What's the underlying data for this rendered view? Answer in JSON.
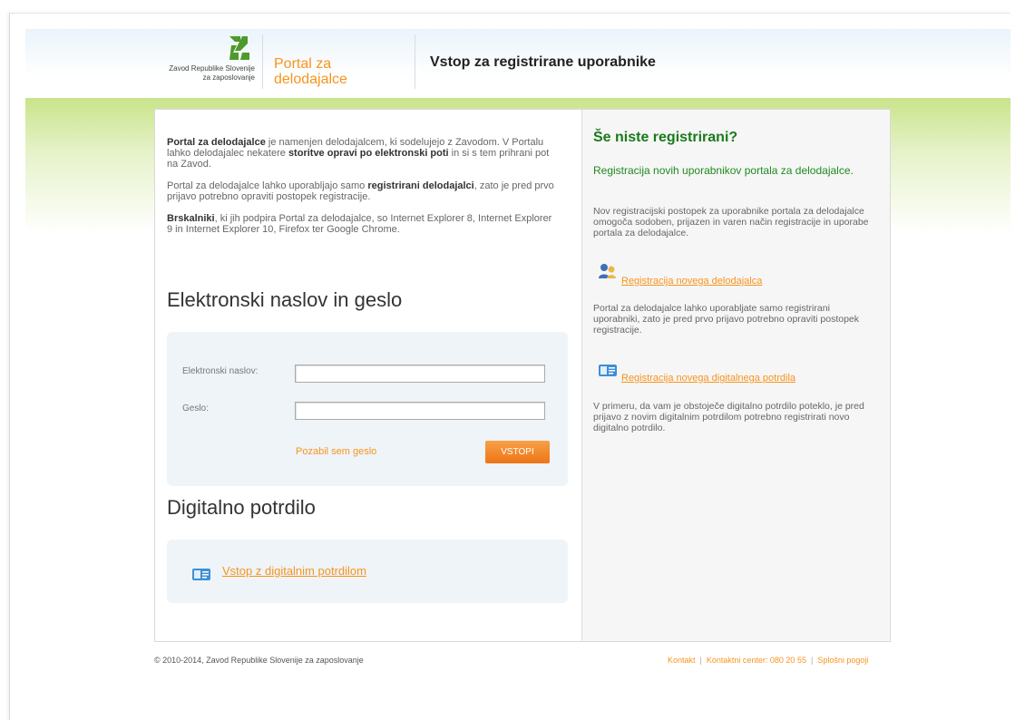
{
  "header": {
    "org_line1": "Zavod Republike Slovenije",
    "org_line2": "za zaposlovanje",
    "portal_line1": "Portal za",
    "portal_line2": "delodajalce",
    "title": "Vstop za registrirane uporabnike"
  },
  "intro": {
    "p1_b1": "Portal za delodajalce",
    "p1_t1": " je namenjen delodajalcem, ki sodelujejo z Zavodom. V Portalu lahko delodajalec nekatere ",
    "p1_b2": "storitve opravi po elektronski poti",
    "p1_t2": " in si s tem prihrani pot na Zavod.",
    "p2_t1": "Portal za delodajalce lahko uporabljajo samo ",
    "p2_b1": "registrirani delodajalci",
    "p2_t2": ", zato je pred prvo prijavo potrebno opraviti postopek registracije.",
    "p3_b1": "Brskalniki",
    "p3_t1": ", ki jih podpira Portal za delodajalce, so Internet Explorer 8, Internet Explorer 9 in Internet Explorer 10, Firefox ter Google Chrome."
  },
  "login": {
    "section_title": "Elektronski naslov in geslo",
    "email_label": "Elektronski naslov:",
    "email_value": "",
    "password_label": "Geslo:",
    "password_value": "",
    "forgot_label": "Pozabil sem geslo",
    "submit_label": "VSTOPI"
  },
  "certificate": {
    "section_title": "Digitalno potrdilo",
    "link_label": "Vstop z digitalnim potrdilom"
  },
  "sidebar": {
    "title": "Še niste registrirani?",
    "subtitle": "Registracija novih uporabnikov portala za delodajalce.",
    "text1": "Nov registracijski postopek za uporabnike portala za delodajalce omogoča sodoben, prijazen in varen način registracije in uporabe portala za delodajalce.",
    "link1": "Registracija novega delodajalca",
    "text2": "Portal za delodajalce lahko uporabljate samo registrirani uporabniki, zato je pred prvo prijavo potrebno opraviti postopek registracije.",
    "link2": "Registracija novega digitalnega potrdila",
    "text3": "V primeru, da vam je obstoječe digitalno potrdilo poteklo, je pred prijavo z novim digitalnim potrdilom potrebno registrirati novo digitalno potrdilo."
  },
  "footer": {
    "copyright": "© 2010-2014, Zavod Republike Slovenije za zaposlovanje",
    "contact": "Kontakt",
    "contact_center": "Kontaktni center: 080 20 55",
    "terms": "Splošni pogoji",
    "separator": "|"
  },
  "colors": {
    "accent_orange": "#f7941d",
    "brand_green": "#1a7a1a",
    "logo_green": "#4e9a2a"
  }
}
